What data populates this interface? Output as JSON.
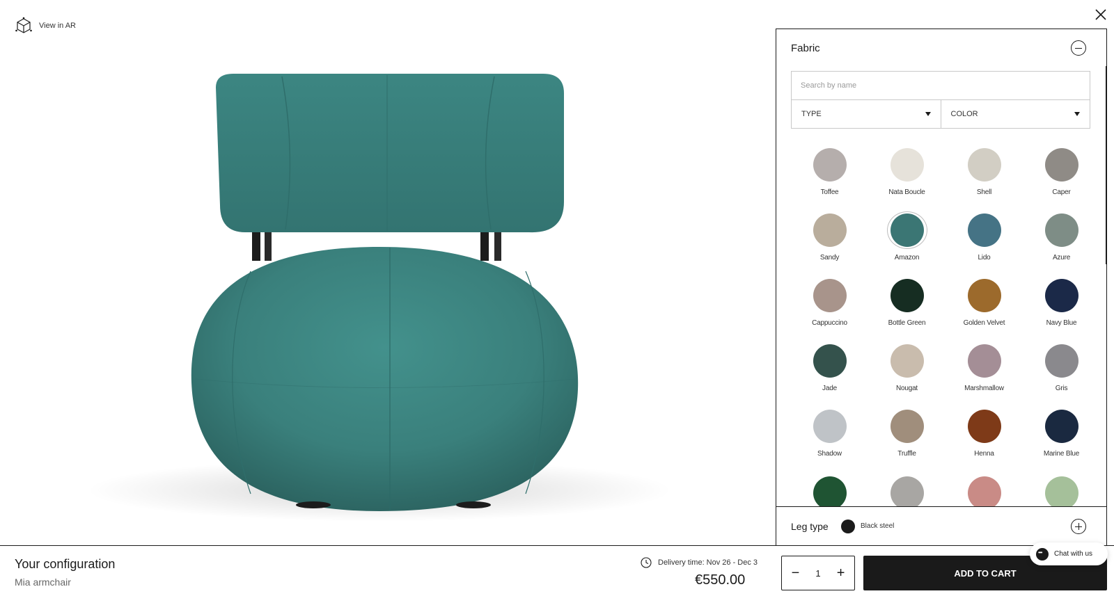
{
  "viewer": {
    "ar_label": "View in AR",
    "close_icon": "close-icon",
    "colors": {
      "upholstery": "#3a807c",
      "legs": "#1c1c1c"
    }
  },
  "panel": {
    "title": "Fabric",
    "search_placeholder": "Search by name",
    "filters": [
      {
        "label": "TYPE"
      },
      {
        "label": "COLOR"
      }
    ],
    "selected_swatch": "Amazon",
    "swatches": [
      {
        "name": "Toffee",
        "color": "#b5aeac"
      },
      {
        "name": "Nata Boucle",
        "color": "#e6e2da"
      },
      {
        "name": "Shell",
        "color": "#d2cec4"
      },
      {
        "name": "Caper",
        "color": "#8f8b86"
      },
      {
        "name": "Sandy",
        "color": "#b9ad9c"
      },
      {
        "name": "Amazon",
        "color": "#3b7674"
      },
      {
        "name": "Lido",
        "color": "#457385"
      },
      {
        "name": "Azure",
        "color": "#7e8d86"
      },
      {
        "name": "Cappuccino",
        "color": "#a8948b"
      },
      {
        "name": "Bottle Green",
        "color": "#162d22"
      },
      {
        "name": "Golden Velvet",
        "color": "#9c6a2c"
      },
      {
        "name": "Navy Blue",
        "color": "#1b2948"
      },
      {
        "name": "Jade",
        "color": "#34524c"
      },
      {
        "name": "Nougat",
        "color": "#c9bcad"
      },
      {
        "name": "Marshmallow",
        "color": "#a48e96"
      },
      {
        "name": "Gris",
        "color": "#8a898d"
      },
      {
        "name": "Shadow",
        "color": "#bfc3c7"
      },
      {
        "name": "Truffle",
        "color": "#a08e7c"
      },
      {
        "name": "Henna",
        "color": "#7e3a18"
      },
      {
        "name": "Marine Blue",
        "color": "#1a2940"
      },
      {
        "name": "",
        "color": "#1f5433"
      },
      {
        "name": "",
        "color": "#a8a6a3"
      },
      {
        "name": "",
        "color": "#c98b86"
      },
      {
        "name": "",
        "color": "#a5c09a"
      }
    ]
  },
  "leg": {
    "title": "Leg type",
    "value": "Black steel",
    "color": "#1b1b1b"
  },
  "chat": {
    "label": "Chat with us"
  },
  "footer": {
    "title": "Your configuration",
    "product": "Mia armchair",
    "delivery": "Delivery time: Nov 26 - Dec 3",
    "price": "€550.00",
    "quantity": "1",
    "minus": "−",
    "plus": "+",
    "cart_label": "ADD TO CART"
  }
}
